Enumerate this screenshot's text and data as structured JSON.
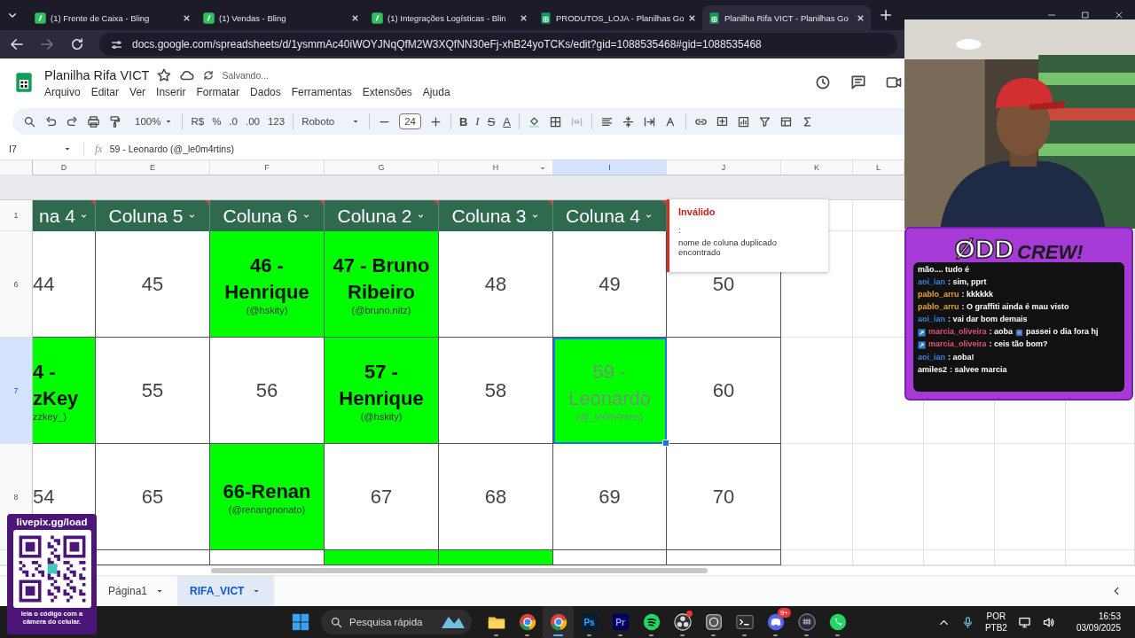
{
  "browser": {
    "tabs": [
      {
        "title": "(1) Frente de Caixa - Bling",
        "kind": "bling",
        "selected": false
      },
      {
        "title": "(1) Vendas - Bling",
        "kind": "bling",
        "selected": false
      },
      {
        "title": "(1) Integrações Logísticas - Blin",
        "kind": "bling",
        "selected": false
      },
      {
        "title": "PRODUTOS_LOJA - Planilhas Go",
        "kind": "sheets",
        "selected": false
      },
      {
        "title": "Planilha Rifa VICT - Planilhas Go",
        "kind": "sheets",
        "selected": true
      }
    ],
    "url": "docs.google.com/spreadsheets/d/1ysmmAc40iWOYJNqQfM2W3XQfNN30eFj-xhB24yoTCKs/edit?gid=1088535468#gid=1088535468"
  },
  "document": {
    "title": "Planilha Rifa VICT",
    "save_status": "Salvando...",
    "menu": [
      "Arquivo",
      "Editar",
      "Ver",
      "Inserir",
      "Formatar",
      "Dados",
      "Ferramentas",
      "Extensões",
      "Ajuda"
    ]
  },
  "toolbar": {
    "zoom": "100%",
    "number_formats": [
      "R$",
      "%",
      ".0",
      ".00",
      "123"
    ],
    "font": "Roboto",
    "font_size": "24",
    "text_styles": [
      "B",
      "I",
      "S",
      "A"
    ]
  },
  "formula_bar": {
    "cell": "I7",
    "fx": "fx",
    "content": "59 - Leonardo (@_le0m4rtins)"
  },
  "sheet": {
    "columns": [
      {
        "label": "D",
        "selected": false,
        "filter_arrow": false
      },
      {
        "label": "E",
        "selected": false,
        "filter_arrow": false
      },
      {
        "label": "F",
        "selected": false,
        "filter_arrow": false
      },
      {
        "label": "G",
        "selected": false,
        "filter_arrow": false
      },
      {
        "label": "H",
        "selected": false,
        "filter_arrow": true
      },
      {
        "label": "I",
        "selected": true,
        "filter_arrow": false
      },
      {
        "label": "J",
        "selected": false,
        "filter_arrow": false
      },
      {
        "label": "K",
        "selected": false,
        "filter_arrow": false
      },
      {
        "label": "L",
        "selected": false
      }
    ],
    "header_row": {
      "number": "1",
      "cells": [
        {
          "text": "na 4",
          "flagged": true
        },
        {
          "text": "Coluna 5",
          "flagged": true
        },
        {
          "text": "Coluna 6",
          "flagged": true
        },
        {
          "text": "Coluna 2",
          "flagged": true
        },
        {
          "text": "Coluna 3",
          "flagged": true
        },
        {
          "text": "Coluna 4",
          "flagged": true
        }
      ]
    },
    "rows": [
      {
        "kind": "full",
        "number": "6",
        "selected": false,
        "cells": [
          {
            "text": "44",
            "filled": false,
            "selected": false
          },
          {
            "text": "45",
            "filled": false,
            "selected": false
          },
          {
            "text": "46 - Henrique",
            "sub": "(@hskity)",
            "filled": true,
            "selected": false
          },
          {
            "text": "47 - Bruno Ribeiro",
            "sub": "(@bruno.nitz)",
            "filled": true,
            "selected": false
          },
          {
            "text": "48",
            "filled": false,
            "selected": false
          },
          {
            "text": "49",
            "filled": false,
            "selected": false
          },
          {
            "text": "50",
            "filled": false,
            "selected": false
          }
        ]
      },
      {
        "kind": "full",
        "number": "7",
        "selected": true,
        "cells": [
          {
            "text": "4 - zKey",
            "sub": "zzkey_)",
            "filled": true,
            "selected": false
          },
          {
            "text": "55",
            "filled": false,
            "selected": false
          },
          {
            "text": "56",
            "filled": false,
            "selected": false
          },
          {
            "text": "57 - Henrique",
            "sub": "(@hskity)",
            "filled": true,
            "selected": false
          },
          {
            "text": "58",
            "filled": false,
            "selected": false
          },
          {
            "text": "59 - Leonardo",
            "sub": "(@_le0m4rtins)",
            "filled": true,
            "selected": true
          },
          {
            "text": "60",
            "filled": false,
            "selected": false
          }
        ]
      },
      {
        "kind": "full",
        "number": "8",
        "selected": false,
        "cells": [
          {
            "text": "54",
            "filled": false,
            "selected": false
          },
          {
            "text": "65",
            "filled": false,
            "selected": false
          },
          {
            "text": "66-Renan",
            "sub": "(@renangnonato)",
            "filled": true,
            "selected": false
          },
          {
            "text": "67",
            "filled": false,
            "selected": false
          },
          {
            "text": "68",
            "filled": false,
            "selected": false
          },
          {
            "text": "69",
            "filled": false,
            "selected": false
          },
          {
            "text": "70",
            "filled": false,
            "selected": false
          }
        ]
      },
      {
        "kind": "partial",
        "cells": [
          {
            "filled": false,
            "selected": false
          },
          {
            "filled": false,
            "selected": false
          },
          {
            "filled": true,
            "selected": false
          },
          {
            "filled": true,
            "selected": false
          },
          {
            "filled": false,
            "selected": false
          },
          {
            "filled": false,
            "selected": false
          }
        ]
      }
    ]
  },
  "comment": {
    "title": "Inválido",
    "mark": ":",
    "message": "nome de coluna duplicado encontrado"
  },
  "sheet_tabs": [
    {
      "label": "Página1",
      "selected": false
    },
    {
      "label": "RIFA_VICT",
      "selected": true
    }
  ],
  "taskbar": {
    "search_placeholder": "Pesquisa rápida",
    "apps": [
      {
        "kind": "folder",
        "active": false,
        "alert": false
      },
      {
        "kind": "chrome",
        "active": false,
        "alert": false
      },
      {
        "kind": "chrome",
        "active": true,
        "alert": false
      },
      {
        "kind": "ps",
        "label": "Ps",
        "active": false,
        "alert": false
      },
      {
        "kind": "pr",
        "label": "Pr",
        "active": false,
        "alert": false
      },
      {
        "kind": "spotify",
        "active": false,
        "alert": false
      },
      {
        "kind": "obs",
        "active": false,
        "alert": true
      },
      {
        "kind": "app",
        "active": false,
        "alert": false
      },
      {
        "kind": "terminal",
        "active": false,
        "alert": false
      },
      {
        "kind": "discord",
        "badge": "9+",
        "active": false,
        "alert": false
      },
      {
        "kind": "keyboard",
        "active": false,
        "alert": false
      },
      {
        "kind": "whatsapp",
        "active": false,
        "alert": false
      }
    ],
    "language": "POR",
    "layout": "PTB2",
    "time": "16:53",
    "date": "03/09/2025"
  },
  "stream": {
    "chat": {
      "logo": "ØDD",
      "logo_2": "CREW!",
      "messages": [
        {
          "text": "mão.... tudo é",
          "badge": false
        },
        {
          "user": "aoi_ian",
          "color": "#3b82e0",
          "text": ": sim, pprt",
          "badge": false
        },
        {
          "user": "pablo_arru",
          "color": "#e8a530",
          "text": ": kkkkkk",
          "badge": false
        },
        {
          "user": "pablo_arru",
          "color": "#e8a530",
          "text": ": O graffiti ainda é mau visto",
          "badge": false
        },
        {
          "user": "aoi_ian",
          "color": "#3b82e0",
          "text": ": vai dar bom demais",
          "badge": false
        },
        {
          "user": "marcia_oliveira",
          "color": "#e0507a",
          "text": ": aoba",
          "after_emote": "passei o dia fora hj",
          "badge": true
        },
        {
          "user": "marcia_oliveira",
          "color": "#e0507a",
          "text": ": ceis tão bom?",
          "badge": true
        },
        {
          "user": "aoi_ian",
          "color": "#3b82e0",
          "text": ": aoba!",
          "badge": false
        },
        {
          "user": "amiles2",
          "color": "#ffffff",
          "text": ": salvee marcia",
          "badge": false
        }
      ]
    },
    "donation": {
      "title": "livepix.gg/load",
      "caption": "leia o código com a câmera do celular."
    }
  }
}
